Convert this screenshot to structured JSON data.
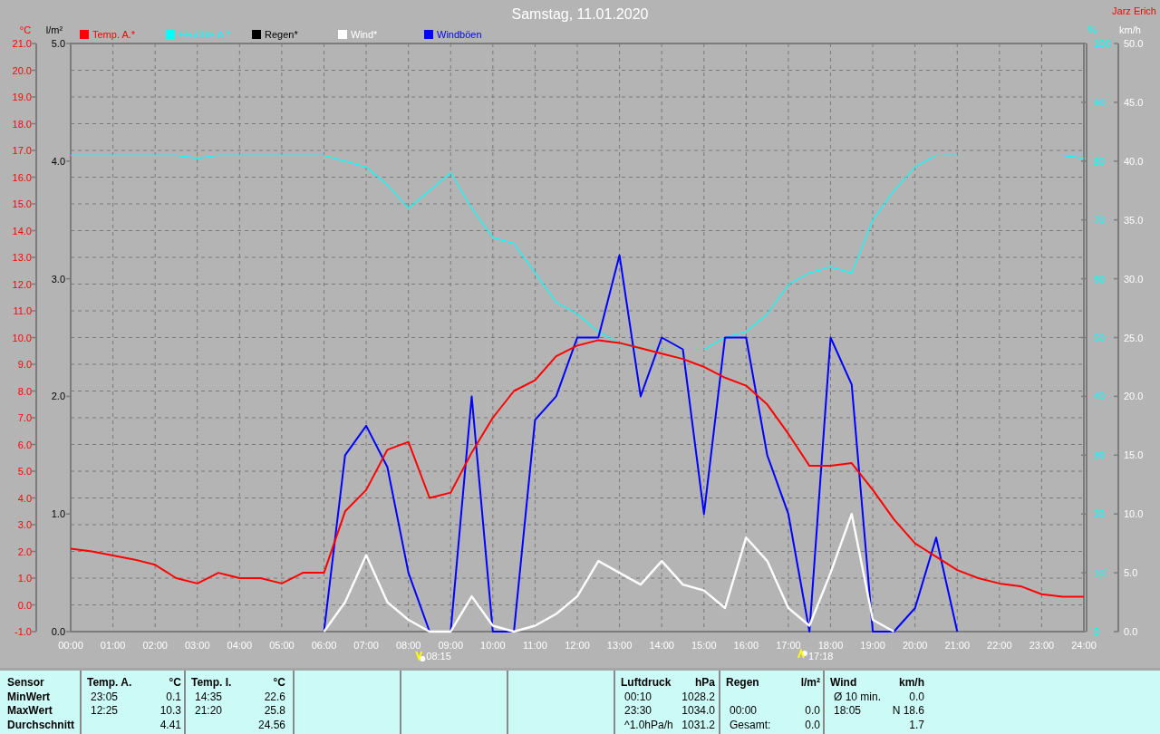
{
  "header": {
    "title": "Samstag, 11.01.2020",
    "author": "Jarz Erich"
  },
  "rain_axis": {
    "title": "l/m²",
    "legend_label": "Regen*",
    "color": "#000000",
    "ticks": [
      "5.0",
      "4.0",
      "3.0",
      "2.0",
      "1.0",
      "0.0"
    ]
  },
  "charts": [
    {
      "kind": "temp",
      "unit": "°C",
      "chart_data": {
        "type": "line",
        "legend": "top",
        "grid": true,
        "xlim": [
          0,
          24
        ],
        "x": [
          0,
          0.5,
          1,
          1.5,
          2,
          2.5,
          3,
          3.5,
          4,
          4.5,
          5,
          5.5,
          6,
          6.5,
          7,
          7.5,
          8,
          8.5,
          9,
          9.5,
          10,
          10.5,
          11,
          11.5,
          12,
          12.5,
          13,
          13.5,
          14,
          14.5,
          15,
          15.5,
          16,
          16.5,
          17,
          17.5,
          18,
          18.5,
          19,
          19.5,
          20,
          20.5,
          21,
          21.5,
          22,
          22.5,
          23,
          23.5,
          24
        ],
        "xticks": [
          {
            "value": 0,
            "label": "00:00"
          },
          {
            "value": 1,
            "label": "01:00"
          },
          {
            "value": 2,
            "label": "02:00"
          },
          {
            "value": 3,
            "label": "03:00"
          },
          {
            "value": 4,
            "label": "04:00"
          },
          {
            "value": 5,
            "label": "05:00"
          },
          {
            "value": 6,
            "label": "06:00"
          },
          {
            "value": 7,
            "label": "07:00"
          },
          {
            "value": 8,
            "label": "08:00"
          },
          {
            "value": 9,
            "label": "09:00"
          },
          {
            "value": 10,
            "label": "10:00"
          },
          {
            "value": 11,
            "label": "11:00"
          },
          {
            "value": 12,
            "label": "12:00"
          },
          {
            "value": 13,
            "label": "13:00"
          },
          {
            "value": 14,
            "label": "14:00"
          },
          {
            "value": 15,
            "label": "15:00"
          },
          {
            "value": 16,
            "label": "16:00"
          },
          {
            "value": 17,
            "label": "17:00"
          },
          {
            "value": 18,
            "label": "18:00"
          },
          {
            "value": 19,
            "label": "19:00"
          },
          {
            "value": 20,
            "label": "20:00"
          },
          {
            "value": 21,
            "label": "21:00"
          },
          {
            "value": 22,
            "label": "22:00"
          },
          {
            "value": 23,
            "label": "23:00"
          },
          {
            "value": 24,
            "label": "24:00"
          }
        ],
        "ylim": [
          -1,
          21
        ],
        "yticks": [
          {
            "value": -1,
            "label": "-1.0"
          },
          {
            "value": 0,
            "label": "0.0"
          },
          {
            "value": 1,
            "label": "1.0"
          },
          {
            "value": 2,
            "label": "2.0"
          },
          {
            "value": 3,
            "label": "3.0"
          },
          {
            "value": 4,
            "label": "4.0"
          },
          {
            "value": 5,
            "label": "5.0"
          },
          {
            "value": 6,
            "label": "6.0"
          },
          {
            "value": 7,
            "label": "7.0"
          },
          {
            "value": 8,
            "label": "8.0"
          },
          {
            "value": 9,
            "label": "9.0"
          },
          {
            "value": 10,
            "label": "10.0"
          },
          {
            "value": 11,
            "label": "11.0"
          },
          {
            "value": 12,
            "label": "12.0"
          },
          {
            "value": 13,
            "label": "13.0"
          },
          {
            "value": 14,
            "label": "14.0"
          },
          {
            "value": 15,
            "label": "15.0"
          },
          {
            "value": 16,
            "label": "16.0"
          },
          {
            "value": 17,
            "label": "17.0"
          },
          {
            "value": 18,
            "label": "18.0"
          },
          {
            "value": 19,
            "label": "19.0"
          },
          {
            "value": 20,
            "label": "20.0"
          },
          {
            "value": 21,
            "label": "21.0"
          }
        ],
        "series": [
          {
            "name": "Temp. A.*",
            "color": "#ff0000",
            "values": [
              2.1,
              2.0,
              1.85,
              1.7,
              1.5,
              1.0,
              0.8,
              1.2,
              1.0,
              1.0,
              0.8,
              1.2,
              1.2,
              3.5,
              4.3,
              5.8,
              6.1,
              4.0,
              4.2,
              5.7,
              7.0,
              8.0,
              8.4,
              9.3,
              9.7,
              9.9,
              9.8,
              9.6,
              9.4,
              9.2,
              8.9,
              8.5,
              8.2,
              7.5,
              6.4,
              5.2,
              5.2,
              5.3,
              4.3,
              3.2,
              2.3,
              1.8,
              1.3,
              1.0,
              0.8,
              0.7,
              0.4,
              0.3,
              0.3
            ]
          }
        ]
      }
    },
    {
      "kind": "humidity",
      "unit": "%",
      "chart_data": {
        "type": "line",
        "legend": "top",
        "xlim": [
          0,
          24
        ],
        "x": [
          0,
          0.5,
          1,
          1.5,
          2,
          2.5,
          3,
          3.5,
          4,
          4.5,
          5,
          5.5,
          6,
          6.5,
          7,
          7.5,
          8,
          8.5,
          9,
          9.5,
          10,
          10.5,
          11,
          11.5,
          12,
          12.5,
          13,
          13.5,
          14,
          14.5,
          15,
          15.5,
          16,
          16.5,
          17,
          17.5,
          18,
          18.5,
          19,
          19.5,
          20,
          20.5,
          21,
          21.5,
          22,
          22.5,
          23,
          23.5,
          24
        ],
        "ylim": [
          0,
          100
        ],
        "yticks": [
          0,
          10,
          20,
          30,
          40,
          50,
          60,
          70,
          80,
          90,
          100
        ],
        "series": [
          {
            "name": "Feuchte A.*",
            "color": "#00ffff",
            "values": [
              81,
              81,
              81,
              81,
              81,
              81,
              80.5,
              81,
              81,
              81,
              81,
              81,
              81,
              80,
              79,
              76,
              72,
              75,
              78,
              72,
              67,
              66,
              61,
              56,
              54,
              51,
              49,
              48,
              48,
              48,
              48,
              50,
              51,
              54,
              59,
              61,
              62,
              61,
              70,
              75,
              79,
              81,
              81,
              null,
              null,
              null,
              null,
              81,
              80.5
            ]
          }
        ]
      }
    },
    {
      "kind": "wind",
      "unit": "km/h",
      "chart_data": {
        "type": "line",
        "legend": "top",
        "xlim": [
          0,
          24
        ],
        "x": [
          6,
          6.5,
          7,
          7.5,
          8,
          8.5,
          9,
          9.5,
          10,
          10.5,
          11,
          11.5,
          12,
          12.5,
          13,
          13.5,
          14,
          14.5,
          15,
          15.5,
          16,
          16.5,
          17,
          17.5,
          18,
          18.5,
          19,
          19.5,
          20,
          20.5,
          21
        ],
        "ylim": [
          0,
          50
        ],
        "yticks": [
          {
            "value": 0,
            "label": "0.0"
          },
          {
            "value": 5,
            "label": "5.0"
          },
          {
            "value": 10,
            "label": "10.0"
          },
          {
            "value": 15,
            "label": "15.0"
          },
          {
            "value": 20,
            "label": "20.0"
          },
          {
            "value": 25,
            "label": "25.0"
          },
          {
            "value": 30,
            "label": "30.0"
          },
          {
            "value": 35,
            "label": "35.0"
          },
          {
            "value": 40,
            "label": "40.0"
          },
          {
            "value": 45,
            "label": "45.0"
          },
          {
            "value": 50,
            "label": "50.0"
          }
        ],
        "series": [
          {
            "name": "Wind*",
            "color": "#ffffff",
            "values": [
              0,
              2.5,
              6.5,
              2.5,
              1,
              0,
              0,
              3,
              0.5,
              0,
              0.5,
              1.5,
              3,
              6,
              5,
              4,
              6,
              4,
              3.5,
              2,
              8,
              6,
              2,
              0.5,
              5,
              10,
              1,
              0,
              null,
              null,
              null
            ]
          },
          {
            "name": "Windböen",
            "color": "#0000ff",
            "values": [
              0,
              15,
              17.5,
              14,
              5,
              0,
              0,
              20,
              0,
              0,
              18,
              20,
              25,
              25,
              32,
              20,
              25,
              24,
              10,
              25,
              25,
              15,
              10,
              0,
              25,
              21,
              0,
              0,
              2,
              8,
              0
            ]
          }
        ]
      }
    }
  ],
  "sun_events": [
    {
      "kind": "sunrise",
      "time": "08:15"
    },
    {
      "kind": "sunset",
      "time": "17:18"
    }
  ],
  "table": {
    "row_labels": [
      "Sensor",
      "MinWert",
      "MaxWert",
      "Durchschnitt"
    ],
    "groups": [
      {
        "kind": "data",
        "title": "Temp. A.",
        "unit": "°C",
        "rows": [
          {
            "time": "23:05",
            "value": "0.1"
          },
          {
            "time": "12:25",
            "value": "10.3"
          },
          {
            "value": "4.41"
          }
        ]
      },
      {
        "kind": "data",
        "title": "Temp. I.",
        "unit": "°C",
        "rows": [
          {
            "time": "14:35",
            "value": "22.6"
          },
          {
            "time": "21:20",
            "value": "25.8"
          },
          {
            "value": "24.56"
          }
        ]
      },
      {
        "kind": "empty"
      },
      {
        "kind": "empty"
      },
      {
        "kind": "empty"
      },
      {
        "kind": "data",
        "title": "Luftdruck",
        "unit": "hPa",
        "rows": [
          {
            "time": "00:10",
            "value": "1028.2"
          },
          {
            "time": "23:30",
            "value": "1034.0"
          },
          {
            "time": "^1.0hPa/h",
            "value": "1031.2"
          }
        ]
      },
      {
        "kind": "data",
        "title": "Regen",
        "unit": "l/m²",
        "rows": [
          {},
          {
            "time": "00:00",
            "value": "0.0"
          },
          {
            "time": "Gesamt:",
            "value": "0.0"
          }
        ]
      },
      {
        "kind": "data",
        "title": "Wind",
        "unit": "km/h",
        "rows": [
          {
            "time": "Ø 10 min.",
            "value": "0.0"
          },
          {
            "time": "18:05",
            "value": "N 18.6"
          },
          {
            "value": "1.7"
          }
        ]
      }
    ]
  }
}
